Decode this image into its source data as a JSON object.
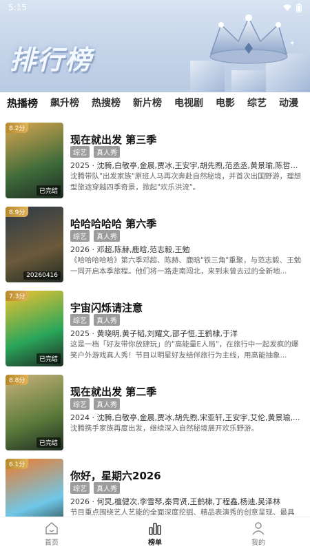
{
  "status_bar": {
    "time": "5:15"
  },
  "banner": {
    "title": "排行榜"
  },
  "tabs": [
    "热播榜",
    "飙升榜",
    "热搜榜",
    "新片榜",
    "电视剧",
    "电影",
    "综艺",
    "动漫"
  ],
  "items": [
    {
      "score": "8.2分",
      "status": "已完结",
      "title": "现在就出发 第三季",
      "tags": [
        "综艺",
        "真人秀"
      ],
      "meta": "2025 · 沈腾,白敬亭,金晨,贾冰,王安宇,胡先煦,范丞丞,黄景瑜,陈哲远...",
      "desc": "沈腾带队\"出发家族\"原班人马再次奔赴自然秘境，并首次出国野游，理想型旅途穿越四季奇景，掀起\"欢乐洪流\"。",
      "poster_colors": [
        "#3e6b3a",
        "#d9a64f"
      ]
    },
    {
      "score": "8.9分",
      "status": "20260416",
      "title": "哈哈哈哈哈 第六季",
      "tags": [
        "综艺",
        "真人秀"
      ],
      "meta": "2026 · 邓超,陈赫,鹿晗,范志毅,王勉",
      "desc": "《哈哈哈哈哈》第六季邓超、陈赫、鹿晗\"铁三角\"重聚，与范志毅、王勉一同开启本季旅程。他们将一路走南闯北，来到未曾去过的全新地...",
      "poster_colors": [
        "#6b5a3a",
        "#2d3a48"
      ]
    },
    {
      "score": "7.3分",
      "status": "已完结",
      "title": "宇宙闪烁请注意",
      "tags": [
        "综艺",
        "真人秀"
      ],
      "meta": "2025 · 黄晓明,黄子韬,刘耀文,邵子恒,王鹤棣,于洋",
      "desc": "这是一档「好友带你放肆玩」的\"高能量E人局\"，在旅行中一起发疯的爆笑户外游戏真人秀！节目以明星好友结伴旅行为主线，用高能抽象...",
      "poster_colors": [
        "#2aa65a",
        "#f2c230"
      ]
    },
    {
      "score": "8.8分",
      "status": "已完结",
      "title": "现在就出发 第二季",
      "tags": [
        "综艺",
        "真人秀"
      ],
      "meta": "2024 · 沈腾,白敬亭,金晨,贾冰,胡先煦,宋亚轩,王安宇,艾伦,黄景瑜,...",
      "desc": "沈腾携手家族再度出发，继续深入自然秘境展开欢乐野游。",
      "poster_colors": [
        "#5a7a3a",
        "#c9b27a"
      ]
    },
    {
      "score": "6.1分",
      "status": "",
      "title": "你好，星期六2026",
      "tags": [
        "综艺",
        "真人秀"
      ],
      "meta": "2026 · 何炅,檀健次,李雪琴,秦霄贤,王鹤棣,丁程鑫,杨迪,吴泽林",
      "desc": "节目重点围绕艺人艺能的全面深度挖掘、精品表演秀的创意呈现、最具",
      "poster_colors": [
        "#6fc7e8",
        "#f07a2a"
      ]
    }
  ],
  "bottom_nav": [
    {
      "label": "首页",
      "icon": "home-icon"
    },
    {
      "label": "榜单",
      "icon": "rank-icon"
    },
    {
      "label": "我的",
      "icon": "user-icon"
    }
  ]
}
